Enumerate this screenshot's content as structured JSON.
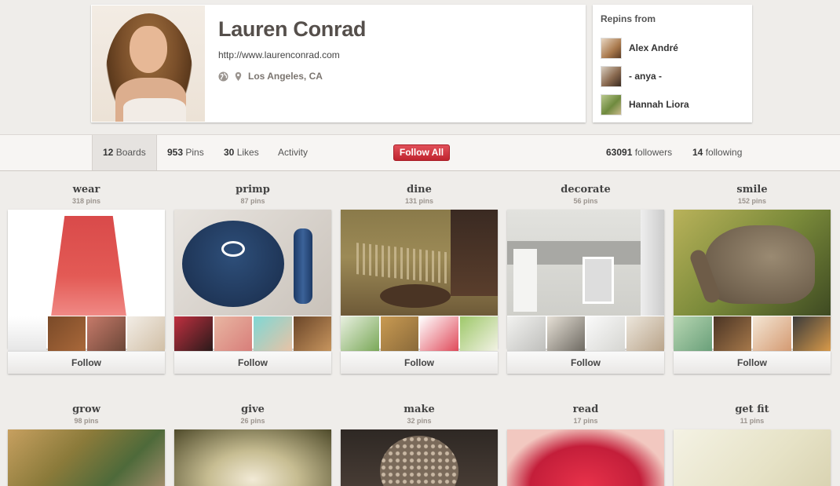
{
  "profile": {
    "name": "Lauren Conrad",
    "url": "http://www.laurenconrad.com",
    "location": "Los Angeles, CA",
    "photo_icon": "profile-photo"
  },
  "repins": {
    "title": "Repins from",
    "users": [
      {
        "name": "Alex André"
      },
      {
        "name": "- anya -"
      },
      {
        "name": "Hannah Liora"
      }
    ]
  },
  "stats": {
    "boards_count": "12",
    "boards_label": "Boards",
    "pins_count": "953",
    "pins_label": "Pins",
    "likes_count": "30",
    "likes_label": "Likes",
    "activity_label": "Activity",
    "follow_all_label": "Follow All",
    "followers_count": "63091",
    "followers_label": "followers",
    "following_count": "14",
    "following_label": "following"
  },
  "boards": [
    {
      "title": "wear",
      "count": "318 pins",
      "follow": "Follow"
    },
    {
      "title": "primp",
      "count": "87 pins",
      "follow": "Follow"
    },
    {
      "title": "dine",
      "count": "131 pins",
      "follow": "Follow"
    },
    {
      "title": "decorate",
      "count": "56 pins",
      "follow": "Follow"
    },
    {
      "title": "smile",
      "count": "152 pins",
      "follow": "Follow"
    },
    {
      "title": "grow",
      "count": "98 pins"
    },
    {
      "title": "give",
      "count": "26 pins"
    },
    {
      "title": "make",
      "count": "32 pins"
    },
    {
      "title": "read",
      "count": "17 pins"
    },
    {
      "title": "get fit",
      "count": "11 pins"
    }
  ],
  "colors": {
    "accent_red": "#c0242f",
    "background": "#efedea"
  }
}
